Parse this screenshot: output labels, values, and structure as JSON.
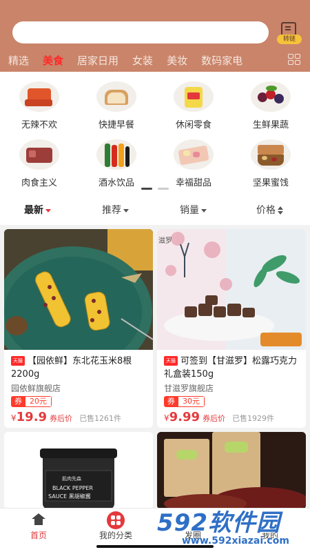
{
  "header": {
    "search": {
      "placeholder": ""
    },
    "transfer_label": "转链",
    "tabs": [
      {
        "label": "精选"
      },
      {
        "label": "美食"
      },
      {
        "label": "居家日用"
      },
      {
        "label": "女装"
      },
      {
        "label": "美妆"
      },
      {
        "label": "数码家电"
      }
    ],
    "active_tab": "美食"
  },
  "categories": [
    {
      "label": "无辣不欢",
      "icon": "spicy-snack-icon"
    },
    {
      "label": "快捷早餐",
      "icon": "bread-icon"
    },
    {
      "label": "休闲零食",
      "icon": "snack-bag-icon"
    },
    {
      "label": "生鲜果蔬",
      "icon": "fruit-icon"
    },
    {
      "label": "肉食主义",
      "icon": "meat-icon"
    },
    {
      "label": "酒水饮品",
      "icon": "drinks-icon"
    },
    {
      "label": "幸福甜品",
      "icon": "dessert-icon"
    },
    {
      "label": "坚果蜜饯",
      "icon": "nuts-icon"
    }
  ],
  "sort": {
    "items": [
      {
        "label": "最新"
      },
      {
        "label": "推荐"
      },
      {
        "label": "销量"
      },
      {
        "label": "价格"
      }
    ],
    "active": "最新"
  },
  "products": [
    {
      "badge": "天猫",
      "title": "【园依鲜】东北花玉米8根2200g",
      "shop": "园依鲜旗舰店",
      "coupon_label": "券",
      "coupon_value": "20元",
      "price_symbol": "¥",
      "price": "19.9",
      "after_label": "券后价",
      "sold": "已售1261件"
    },
    {
      "badge": "天猫",
      "title": "可签到【甘滋罗】松露巧克力礼盒装150g",
      "shop": "甘滋罗旗舰店",
      "coupon_label": "券",
      "coupon_value": "30元",
      "price_symbol": "¥",
      "price": "9.99",
      "after_label": "券后价",
      "sold": "已售1929件"
    },
    {
      "product_text": "肌肉先森 BLACK PEPPER SAUCE 黑胡椒酱"
    },
    {}
  ],
  "bottom_nav": [
    {
      "label": "首页"
    },
    {
      "label": "我的分类"
    },
    {
      "label": "发圈"
    },
    {
      "label": "我的"
    }
  ],
  "watermark": {
    "big": "592软件园",
    "small": "www.592xiazai.com"
  },
  "colors": {
    "header_bg": "#c9846a",
    "accent_red": "#e4393c"
  }
}
